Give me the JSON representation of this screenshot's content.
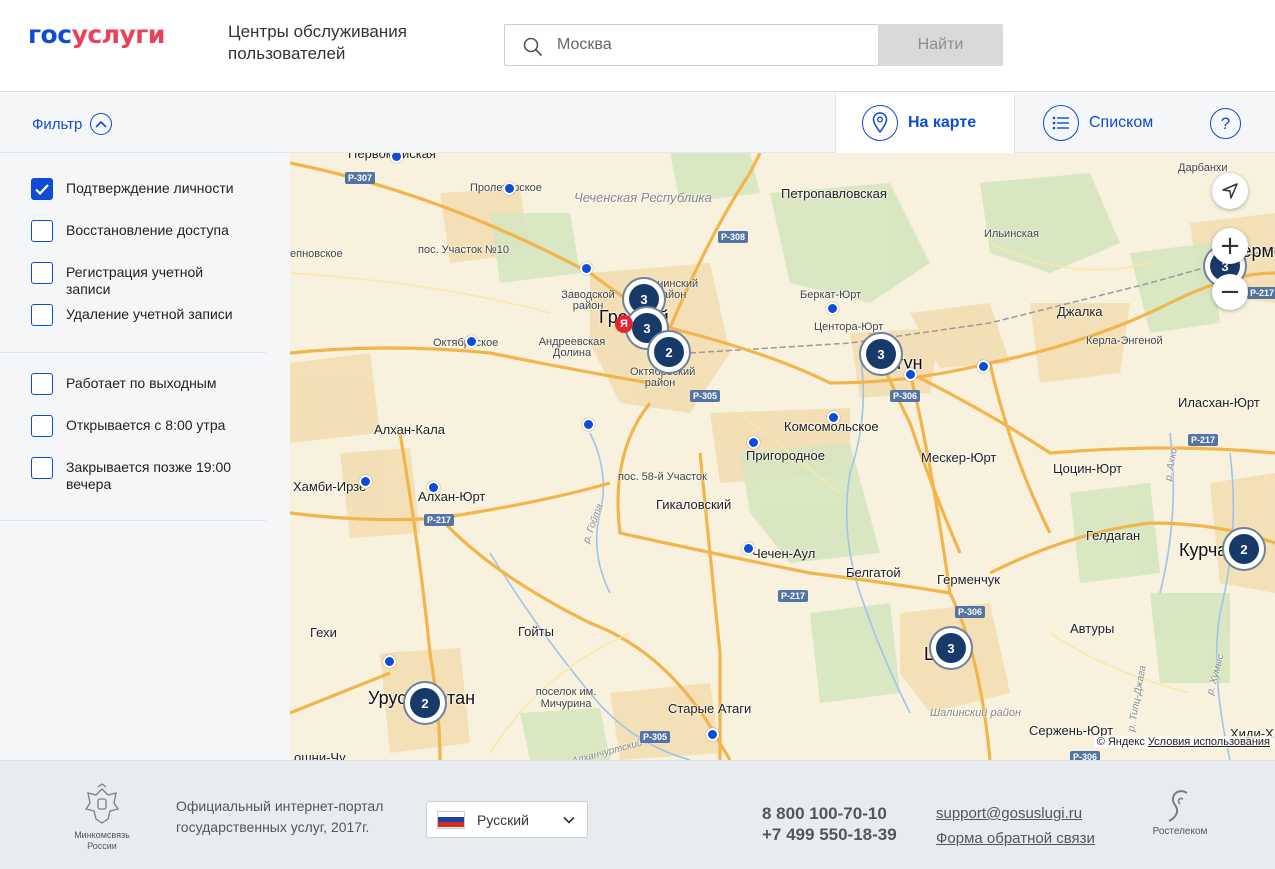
{
  "header": {
    "logo_part1": "гос",
    "logo_part2": "услуги",
    "title": "Центры обслуживания пользователей",
    "search_placeholder": "Москва",
    "search_button": "Найти"
  },
  "toolbar": {
    "filter_label": "Фильтр",
    "tab_map": "На карте",
    "tab_list": "Списком",
    "help": "?"
  },
  "filters": {
    "group1": [
      {
        "label": "Подтверждение личности",
        "checked": true
      },
      {
        "label": "Восстановление доступа",
        "checked": false
      },
      {
        "label": "Регистрация учетной записи",
        "checked": false
      },
      {
        "label": "Удаление учетной записи",
        "checked": false
      }
    ],
    "group2": [
      {
        "label": "Работает по выходным",
        "checked": false
      },
      {
        "label": "Открывается с 8:00 утра",
        "checked": false
      },
      {
        "label": "Закрывается позже 19:00 вечера",
        "checked": false
      }
    ]
  },
  "map": {
    "towns": {
      "pervomayskaya": "Первомайская",
      "prolet": "Пролетарское",
      "chechen_rep": "Чеченская Республика",
      "petropavl": "Петропавловская",
      "ilinskaya": "Ильинская",
      "darbankhi": "Дарбанхи",
      "uchastok10": "пос. Участок №10",
      "penovskoe": "епновское",
      "zavodskoy": "Заводской район",
      "grozny": "Грозный",
      "leninsky": "Ленинский район",
      "berkat": "Беркат-Юрт",
      "tsentora": "Центора-Юрт",
      "dzhalka": "Джалка",
      "kerla": "Керла-Энгеной",
      "gudermes": "Гудермес",
      "oktyabrskoe": "Октябрьское",
      "andreevskaya": "Андреевская Долина",
      "oktyabrsky_r": "Октябрьский район",
      "argun": "Аргун",
      "ilaskhan": "Иласхан-Юрт",
      "alkhan_kala": "Алхан-Кала",
      "komsomolskoe": "Комсомольское",
      "prigorodnoe": "Пригородное",
      "mesker": "Мескер-Юрт",
      "tsotsin": "Цоцин-Юрт",
      "khambi": "Хамби-Ирзе",
      "alkhan_yurt": "Алхан-Юрт",
      "uchastok58": "пос. 58-й Участок",
      "gikalovsky": "Гикаловский",
      "geldagan": "Гелдаган",
      "kurchaloy": "Курчалой",
      "chechen_aul": "Чечен-Аул",
      "belgatoy": "Белгатой",
      "germenchuk": "Герменчук",
      "goyty": "Гойты",
      "gekhi": "Гехи",
      "avtury": "Автуры",
      "shali": "Шали",
      "urus": "Урус-Мартан",
      "michurina": "поселок им. Мичурина",
      "starye_atagi": "Старые Атаги",
      "shalinsky_r": "Шалинский район",
      "serzhen": "Сержень-Юрт",
      "khidi": "Хиди-Х",
      "goyty_river": "р. Гойта",
      "khumys": "р. Хумыс",
      "akhko": "р. Ахко",
      "tipts": "р. Типц-Джага",
      "canal": "Алханчуртский канал",
      "shuni": "ошни-Чу"
    },
    "roads": [
      "Р-307",
      "Р-308",
      "Р-305",
      "Р-306",
      "Р-217",
      "Р-217",
      "Р-217",
      "Р-217",
      "Р-306",
      "Р-217",
      "Р-305",
      "Р-306"
    ],
    "clusters": [
      "3",
      "3",
      "2",
      "3",
      "3",
      "2",
      "3",
      "2"
    ],
    "zoom_in": "+",
    "zoom_out": "−",
    "yandex_logo": "Я",
    "copyright_text": "© Яндекс",
    "terms_link": "Условия использования"
  },
  "footer": {
    "ministry": "Минкомсвязь России",
    "portal_text": "Официальный интернет-портал государственных услуг, 2017г.",
    "language": "Русский",
    "phone1": "8 800 100-70-10",
    "phone2": "+7 499 550-18-39",
    "support_email": "support@gosuslugi.ru",
    "feedback_link": "Форма обратной связи",
    "rostelecom": "Ростелеком"
  }
}
